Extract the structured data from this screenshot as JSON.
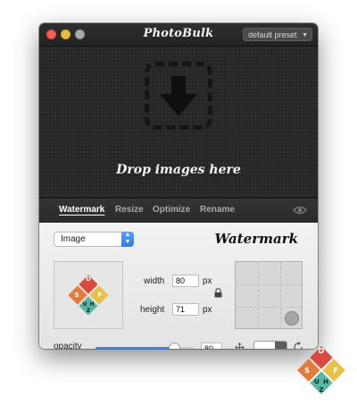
{
  "window": {
    "title": "PhotoBulk",
    "preset": "default preset"
  },
  "dropzone": {
    "text": "Drop images here",
    "icon": "download-arrow-icon"
  },
  "tabs": [
    {
      "label": "Watermark",
      "active": true
    },
    {
      "label": "Resize",
      "active": false
    },
    {
      "label": "Optimize",
      "active": false
    },
    {
      "label": "Rename",
      "active": false
    }
  ],
  "watermark": {
    "type_select": "Image",
    "title": "Watermark",
    "logo_letters": [
      "D",
      "F",
      "S",
      "U",
      "H",
      "Z"
    ],
    "width_label": "width",
    "width_value": "80",
    "height_label": "height",
    "height_value": "71",
    "unit": "px",
    "opacity_label": "opacity",
    "opacity_value": "80",
    "opacity_fraction": 0.8,
    "position": "bottom-right"
  },
  "colors": {
    "accent": "#3a84f0",
    "logo_orange": "#e27c3b",
    "logo_red": "#d94b3f",
    "logo_yellow": "#e7c14a",
    "logo_teal": "#55b7a4"
  }
}
